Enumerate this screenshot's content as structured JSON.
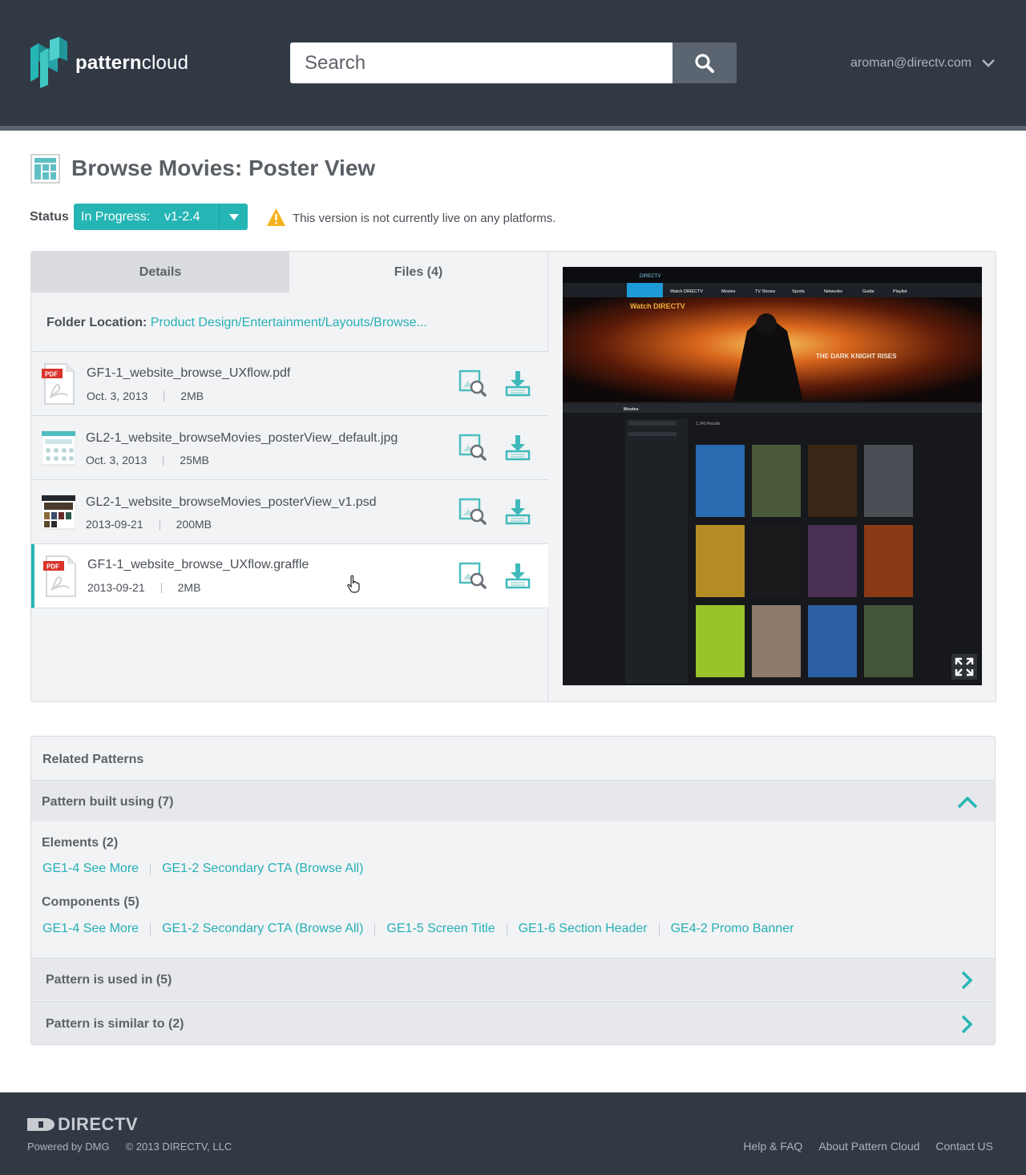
{
  "header": {
    "logo_bold": "pattern",
    "logo_light": "cloud",
    "search_placeholder": "Search",
    "user_email": "aroman@directv.com"
  },
  "page": {
    "title": "Browse Movies: Poster View",
    "status_label": "Status",
    "status_value": "In Progress:    v1-2.4",
    "warning": "This version is not currently live on any platforms."
  },
  "tabs": {
    "details": "Details",
    "files": "Files (4)"
  },
  "folder": {
    "label": "Folder Location:",
    "path": "Product Design/Entertainment/Layouts/Browse..."
  },
  "files": [
    {
      "name": "GF1-1_website_browse_UXflow.pdf",
      "date": "Oct. 3, 2013",
      "size": "2MB",
      "type": "pdf"
    },
    {
      "name": "GL2-1_website_browseMovies_posterView_default.jpg",
      "date": "Oct. 3, 2013",
      "size": "25MB",
      "type": "jpg"
    },
    {
      "name": "GL2-1_website_browseMovies_posterView_v1.psd",
      "date": "2013-09-21",
      "size": "200MB",
      "type": "psd"
    },
    {
      "name": "GF1-1_website_browse_UXflow.graffle",
      "date": "2013-09-21",
      "size": "2MB",
      "type": "pdf"
    }
  ],
  "pdf_badge": "PDF",
  "preview": {
    "brand": "DIRECTV",
    "nav": [
      "Watch DIRECTV",
      "Movies",
      "TV Shows",
      "Sports",
      "Networks",
      "Guide",
      "Playlist"
    ],
    "hero_title": "Watch DIRECTV",
    "hero_caption": "THE DARK KNIGHT RISES",
    "section": "Movies",
    "results": "1,240 Results"
  },
  "related": {
    "title": "Related Patterns",
    "built_using": "Pattern built using (7)",
    "elements_title": "Elements (2)",
    "elements": [
      "GE1-4 See More",
      "GE1-2 Secondary CTA (Browse All)"
    ],
    "components_title": "Components (5)",
    "components": [
      "GE1-4 See More",
      "GE1-2 Secondary CTA (Browse All)",
      "GE1-5 Screen Title",
      "GE1-6 Section Header",
      "GE4-2 Promo Banner"
    ],
    "used_in": "Pattern is used in (5)",
    "similar_to": "Pattern is similar to (2)"
  },
  "footer": {
    "brand": "DIRECTV",
    "powered": "Powered by DMG",
    "copyright": "© 2013 DIRECTV, LLC",
    "links": [
      "Help & FAQ",
      "About Pattern Cloud",
      "Contact US"
    ]
  },
  "colors": {
    "header": "#313945",
    "accent": "#26b5b5",
    "panel": "#f2f3f5"
  }
}
